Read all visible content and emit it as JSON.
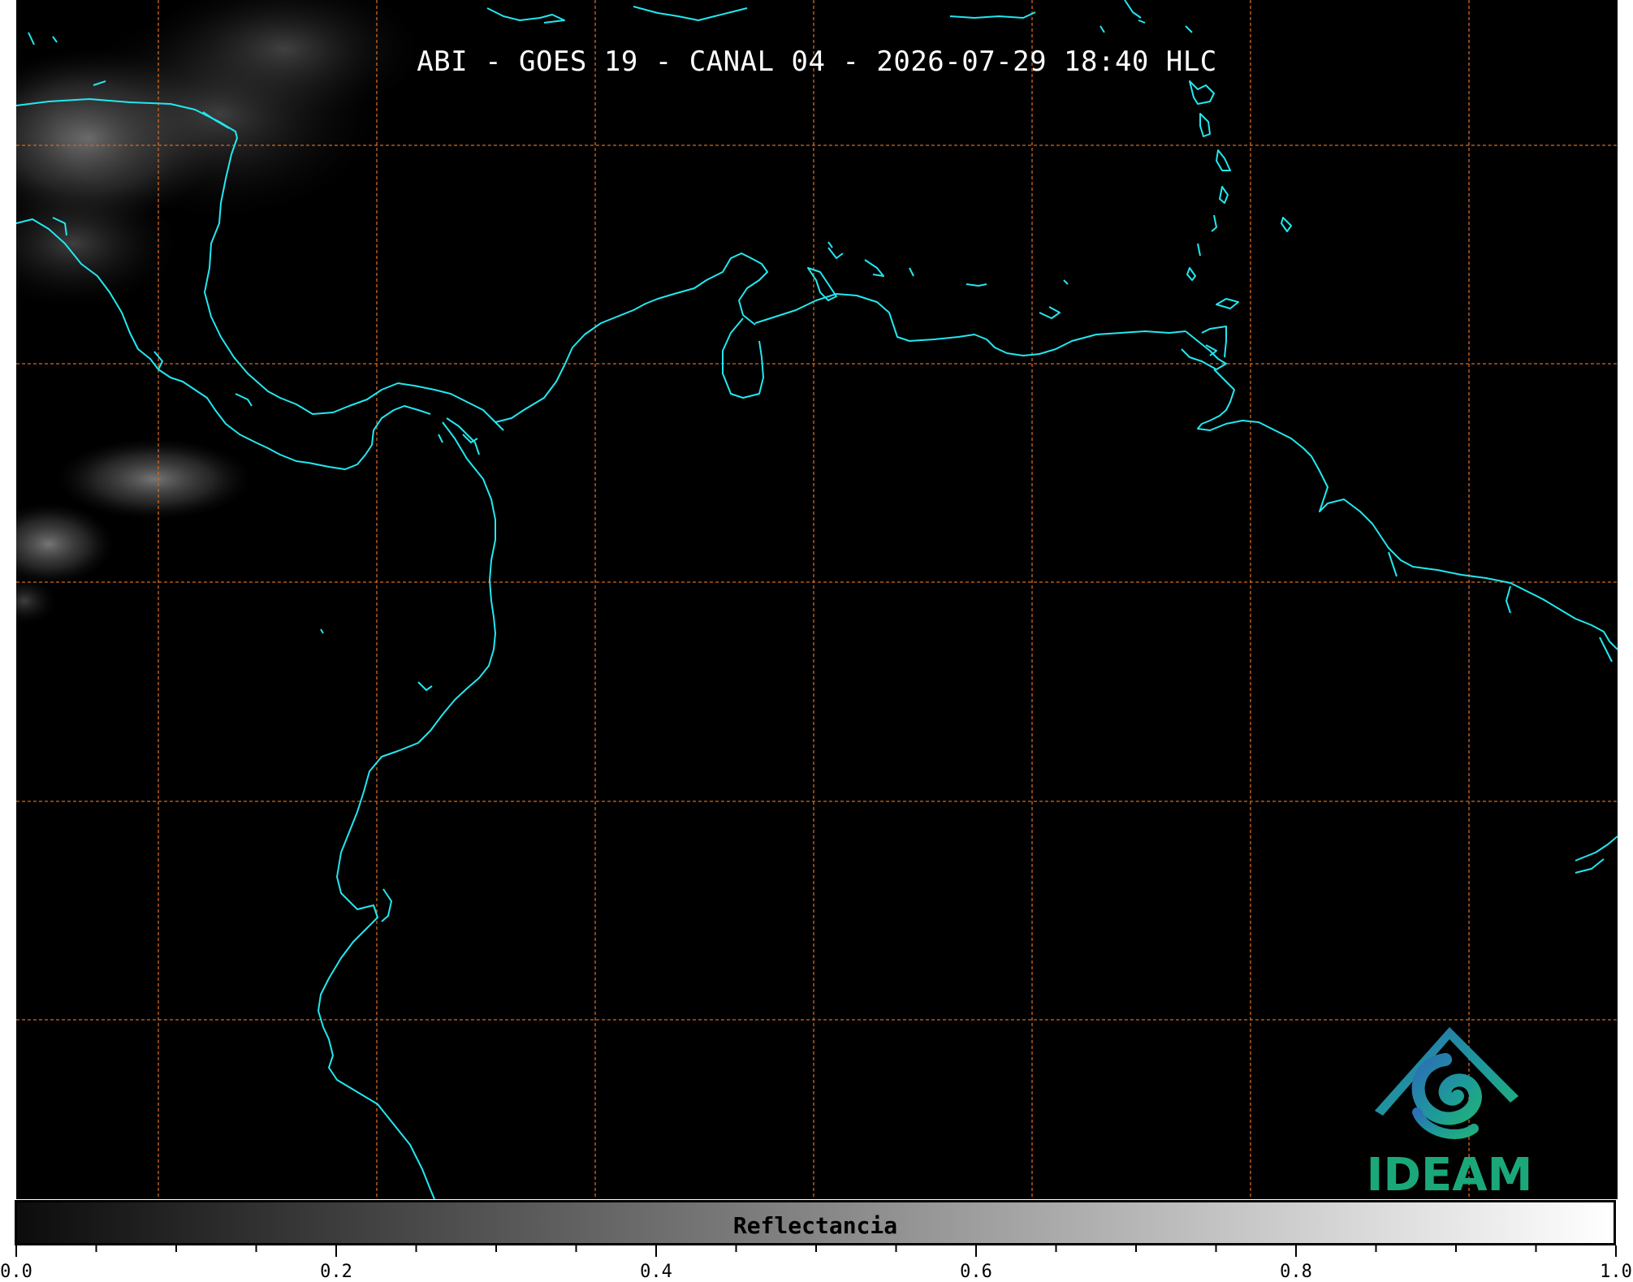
{
  "title": "ABI - GOES 19 - CANAL 04 - 2026-07-29 18:40 HLC",
  "colorbar": {
    "label": "Reflectancia",
    "min": 0.0,
    "max": 1.0,
    "gradient_start": "#0c0c0c",
    "gradient_end": "#ffffff",
    "major_ticks": [
      "0.0",
      "0.2",
      "0.4",
      "0.6",
      "0.8",
      "1.0"
    ],
    "minor_tick_step": 0.05
  },
  "logo": {
    "text": "IDEAM",
    "text_color": "#1aa87a",
    "mark_colors": [
      "#2b6fb5",
      "#1e9a9a",
      "#20b07a"
    ]
  },
  "colors": {
    "background": "#000000",
    "coastline": "#22e8f0",
    "gridline": "#d2691e",
    "title_text": "#ffffff"
  }
}
